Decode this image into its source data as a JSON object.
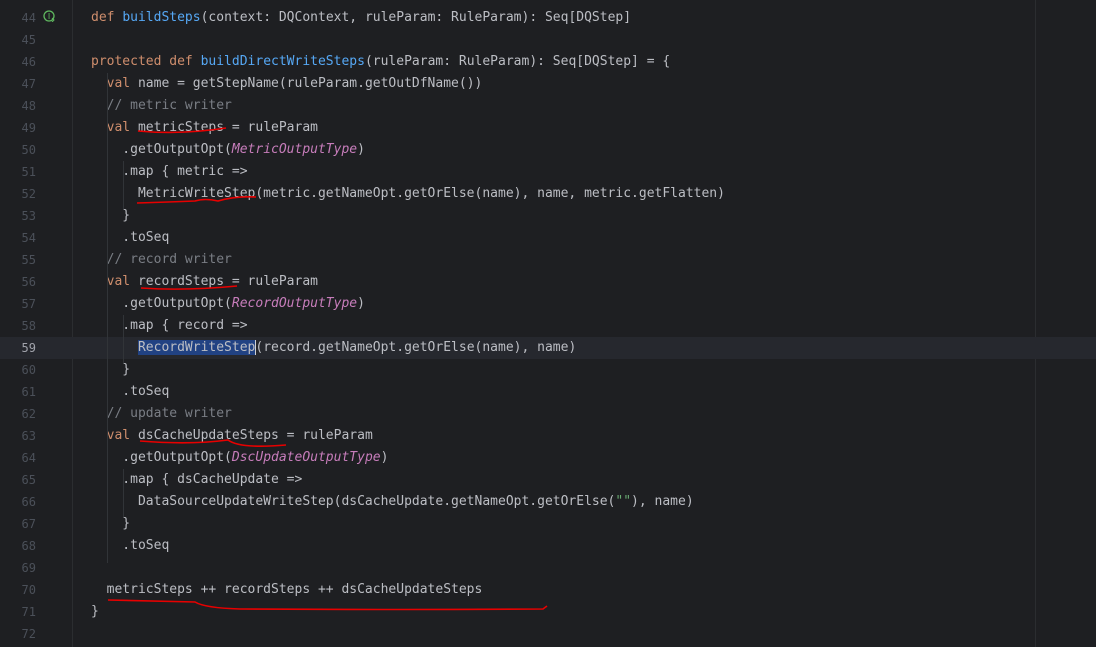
{
  "editor": {
    "current_line": 59,
    "lines": [
      {
        "n": "44",
        "tokens": [
          {
            "t": "def ",
            "c": "k"
          },
          {
            "t": "buildSteps",
            "c": "f"
          },
          {
            "t": "(context: DQContext, ruleParam: RuleParam): Seq[DQStep]"
          }
        ]
      },
      {
        "n": "45",
        "tokens": []
      },
      {
        "n": "46",
        "tokens": [
          {
            "t": "protected def ",
            "c": "k"
          },
          {
            "t": "buildDirectWriteSteps",
            "c": "f"
          },
          {
            "t": "(ruleParam: RuleParam): Seq[DQStep] = {"
          }
        ]
      },
      {
        "n": "47",
        "tokens": [
          {
            "t": "  "
          },
          {
            "t": "val ",
            "c": "k"
          },
          {
            "t": "name = getStepName(ruleParam.getOutDfName())"
          }
        ]
      },
      {
        "n": "48",
        "tokens": [
          {
            "t": "  // metric writer",
            "c": "c"
          }
        ]
      },
      {
        "n": "49",
        "tokens": [
          {
            "t": "  "
          },
          {
            "t": "val ",
            "c": "k"
          },
          {
            "t": "metricSteps = ruleParam"
          }
        ]
      },
      {
        "n": "50",
        "tokens": [
          {
            "t": "    .getOutputOpt("
          },
          {
            "t": "MetricOutputType",
            "c": "it"
          },
          {
            "t": ")"
          }
        ]
      },
      {
        "n": "51",
        "tokens": [
          {
            "t": "    .map { metric =>"
          }
        ]
      },
      {
        "n": "52",
        "tokens": [
          {
            "t": "      MetricWriteStep(metric.getNameOpt.getOrElse(name), name, metric.getFlatten)"
          }
        ]
      },
      {
        "n": "53",
        "tokens": [
          {
            "t": "    }"
          }
        ]
      },
      {
        "n": "54",
        "tokens": [
          {
            "t": "    .toSeq"
          }
        ]
      },
      {
        "n": "55",
        "tokens": [
          {
            "t": "  // record writer",
            "c": "c"
          }
        ]
      },
      {
        "n": "56",
        "tokens": [
          {
            "t": "  "
          },
          {
            "t": "val ",
            "c": "k"
          },
          {
            "t": "recordSteps = ruleParam"
          }
        ]
      },
      {
        "n": "57",
        "tokens": [
          {
            "t": "    .getOutputOpt("
          },
          {
            "t": "RecordOutputType",
            "c": "it"
          },
          {
            "t": ")"
          }
        ]
      },
      {
        "n": "58",
        "tokens": [
          {
            "t": "    .map { record =>"
          }
        ]
      },
      {
        "n": "59",
        "tokens": [
          {
            "t": "      "
          },
          {
            "t": "RecordWriteStep",
            "c": "sel"
          },
          {
            "t": "",
            "c": "caret"
          },
          {
            "t": "(record.getNameOpt.getOrElse(name), name)"
          }
        ]
      },
      {
        "n": "60",
        "tokens": [
          {
            "t": "    }"
          }
        ]
      },
      {
        "n": "61",
        "tokens": [
          {
            "t": "    .toSeq"
          }
        ]
      },
      {
        "n": "62",
        "tokens": [
          {
            "t": "  // update writer",
            "c": "c"
          }
        ]
      },
      {
        "n": "63",
        "tokens": [
          {
            "t": "  "
          },
          {
            "t": "val ",
            "c": "k"
          },
          {
            "t": "dsCacheUpdateSteps = ruleParam"
          }
        ]
      },
      {
        "n": "64",
        "tokens": [
          {
            "t": "    .getOutputOpt("
          },
          {
            "t": "DscUpdateOutputType",
            "c": "it"
          },
          {
            "t": ")"
          }
        ]
      },
      {
        "n": "65",
        "tokens": [
          {
            "t": "    .map { dsCacheUpdate =>"
          }
        ]
      },
      {
        "n": "66",
        "tokens": [
          {
            "t": "      DataSourceUpdateWriteStep(dsCacheUpdate.getNameOpt.getOrElse("
          },
          {
            "t": "\"\"",
            "c": "str"
          },
          {
            "t": "), name)"
          }
        ]
      },
      {
        "n": "67",
        "tokens": [
          {
            "t": "    }"
          }
        ]
      },
      {
        "n": "68",
        "tokens": [
          {
            "t": "    .toSeq"
          }
        ]
      },
      {
        "n": "69",
        "tokens": []
      },
      {
        "n": "70",
        "tokens": [
          {
            "t": "  metricSteps ++ recordSteps ++ dsCacheUpdateSteps"
          }
        ]
      },
      {
        "n": "71",
        "tokens": [
          {
            "t": "}"
          }
        ]
      },
      {
        "n": "72",
        "tokens": []
      }
    ]
  },
  "gutter_icon": "override-method-icon",
  "colors": {
    "background": "#1e1f22",
    "keyword": "#cf8e6d",
    "function": "#56a8f5",
    "comment": "#7a7e85",
    "italic_type": "#c77dbb",
    "string": "#6aab73",
    "selection": "#214283",
    "annotation_red": "#e80000"
  }
}
